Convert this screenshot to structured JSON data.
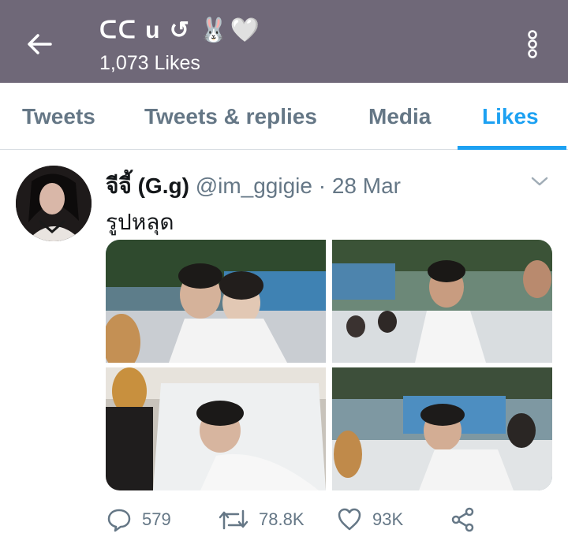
{
  "header": {
    "title": "ᑕᑕ u ↺ 🐰🤍",
    "likes_count": "1,073 Likes",
    "back_icon": "back-arrow-icon",
    "menu_icon": "more-vertical-icon"
  },
  "tabs": [
    {
      "label": "Tweets",
      "active": false
    },
    {
      "label": "Tweets & replies",
      "active": false
    },
    {
      "label": "Media",
      "active": false
    },
    {
      "label": "Likes",
      "active": true
    }
  ],
  "tweet": {
    "author_name": "จีจี้ (G.g)",
    "handle": "@im_ggigie",
    "separator": "·",
    "date": "28 Mar",
    "text": "รูปหลุด",
    "stats": {
      "replies": "579",
      "retweets": "78.8K",
      "likes": "93K"
    }
  },
  "colors": {
    "header_bg": "#6f6878",
    "accent": "#1da1f2",
    "muted": "#657786"
  }
}
